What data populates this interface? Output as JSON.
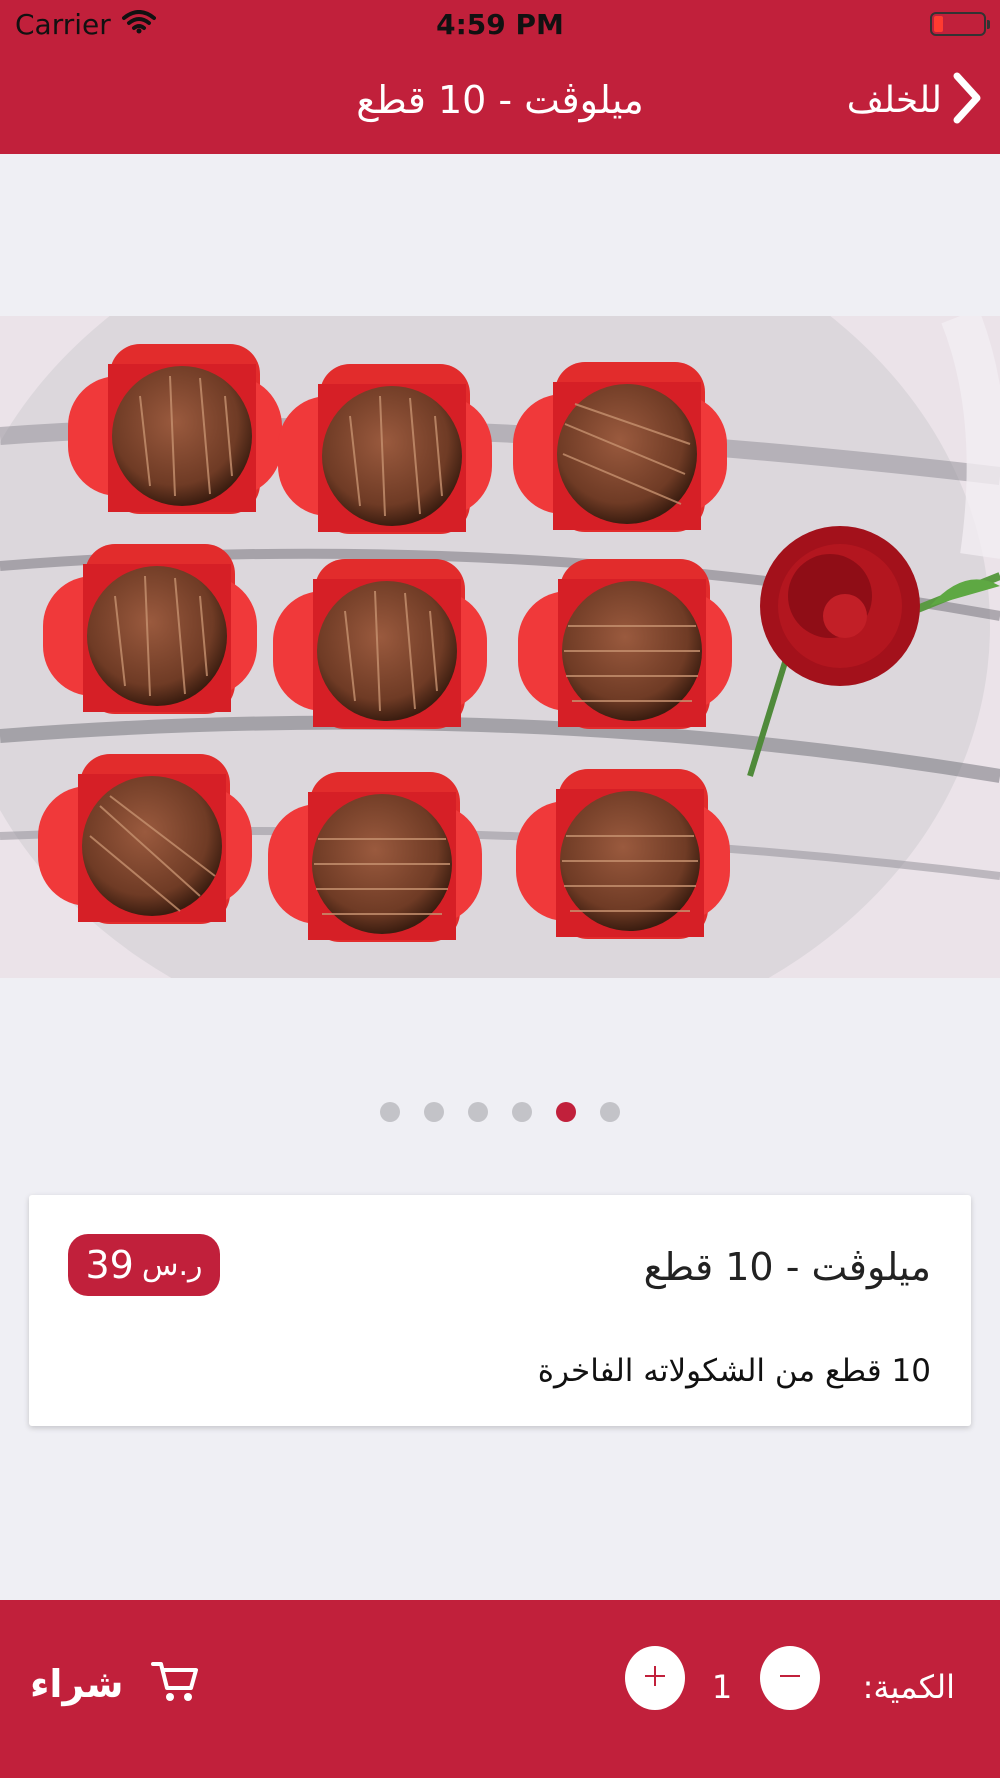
{
  "status_bar": {
    "carrier": "Carrier",
    "time": "4:59 PM"
  },
  "nav": {
    "title": "ميلوڤت - 10 قطع",
    "back_label": "للخلف"
  },
  "gallery": {
    "slide_count": 6,
    "active_index": 4
  },
  "product": {
    "name": "ميلوڤت - 10 قطع",
    "description": "10 قطع من الشكولاته الفاخرة",
    "price_amount": "39",
    "price_currency": "ر.س"
  },
  "bottom_bar": {
    "buy_label": "شراء",
    "quantity_label": "الكمية:",
    "quantity": "1"
  },
  "colors": {
    "brand": "#c1203b",
    "background": "#efeff4",
    "dot_inactive": "#c3c3c8"
  },
  "icons": {
    "back": "chevron-right-icon",
    "cart": "cart-icon",
    "plus": "plus-icon",
    "minus": "minus-icon",
    "wifi": "wifi-icon",
    "battery": "battery-icon"
  }
}
